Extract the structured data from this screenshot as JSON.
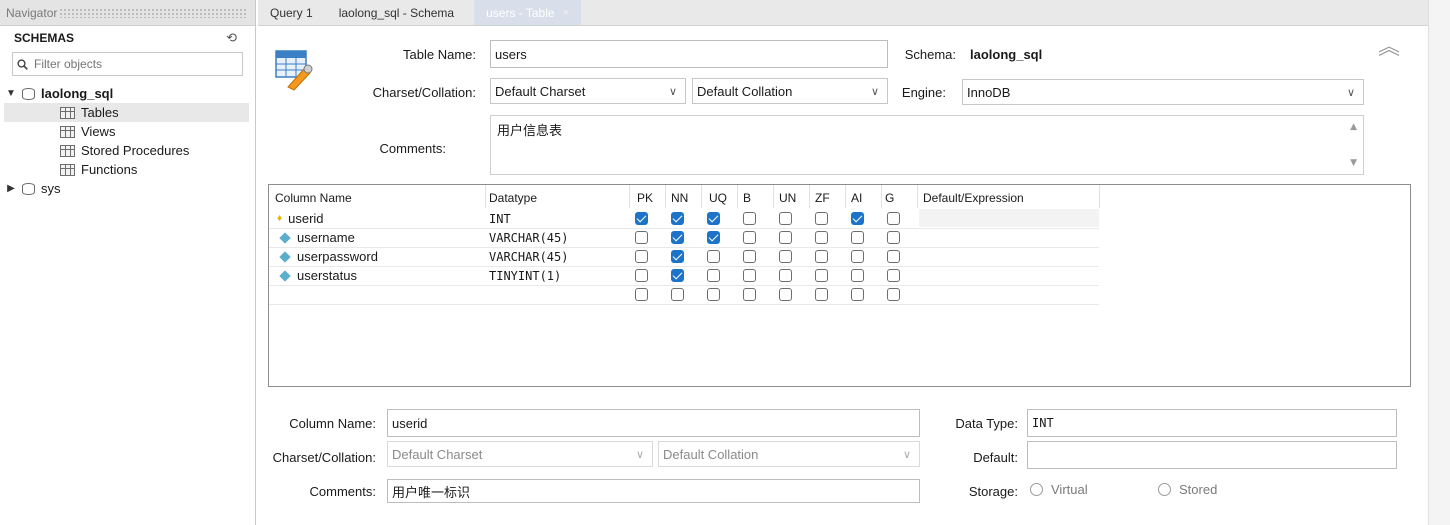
{
  "navigator": {
    "title": "Navigator",
    "schemas_label": "SCHEMAS",
    "filter_placeholder": "Filter objects",
    "schemas": [
      {
        "name": "laolong_sql",
        "expanded": true,
        "children": [
          "Tables",
          "Views",
          "Stored Procedures",
          "Functions"
        ],
        "selected_child": "Tables"
      },
      {
        "name": "sys",
        "expanded": false
      }
    ]
  },
  "tabs": [
    {
      "label": "Query 1",
      "active": false
    },
    {
      "label": "laolong_sql - Schema",
      "active": false
    },
    {
      "label": "users - Table",
      "active": true,
      "close": "×"
    }
  ],
  "table_form": {
    "table_name_label": "Table Name:",
    "table_name": "users",
    "schema_label": "Schema:",
    "schema_value": "laolong_sql",
    "charset_label": "Charset/Collation:",
    "charset_value": "Default Charset",
    "collation_value": "Default Collation",
    "engine_label": "Engine:",
    "engine_value": "InnoDB",
    "comments_label": "Comments:",
    "comments_value": "用户信息表"
  },
  "columns_grid": {
    "headers": [
      "Column Name",
      "Datatype",
      "PK",
      "NN",
      "UQ",
      "B",
      "UN",
      "ZF",
      "AI",
      "G",
      "Default/Expression"
    ],
    "rows": [
      {
        "name": "userid",
        "type": "INT",
        "flags": [
          true,
          true,
          true,
          false,
          false,
          false,
          true,
          false
        ],
        "primary": true
      },
      {
        "name": "username",
        "type": "VARCHAR(45)",
        "flags": [
          false,
          true,
          true,
          false,
          false,
          false,
          false,
          false
        ],
        "primary": false
      },
      {
        "name": "userpassword",
        "type": "VARCHAR(45)",
        "flags": [
          false,
          true,
          false,
          false,
          false,
          false,
          false,
          false
        ],
        "primary": false
      },
      {
        "name": "userstatus",
        "type": "TINYINT(1)",
        "flags": [
          false,
          true,
          false,
          false,
          false,
          false,
          false,
          false
        ],
        "primary": false
      },
      {
        "name": "",
        "type": "",
        "flags": [
          false,
          false,
          false,
          false,
          false,
          false,
          false,
          false
        ],
        "primary": false
      }
    ]
  },
  "column_detail": {
    "column_name_label": "Column Name:",
    "column_name": "userid",
    "data_type_label": "Data Type:",
    "data_type": "INT",
    "charset_label": "Charset/Collation:",
    "charset_value": "Default Charset",
    "collation_value": "Default Collation",
    "default_label": "Default:",
    "default_value": "",
    "comments_label": "Comments:",
    "comments_value": "用户唯一标识",
    "storage_label": "Storage:",
    "storage_options": [
      "Virtual",
      "Stored"
    ]
  },
  "icons": {
    "chevron": "∨",
    "expanded_arrow": "▼",
    "collapsed_arrow": "▶",
    "collapse_panel": "︽",
    "filter": "🔍"
  }
}
